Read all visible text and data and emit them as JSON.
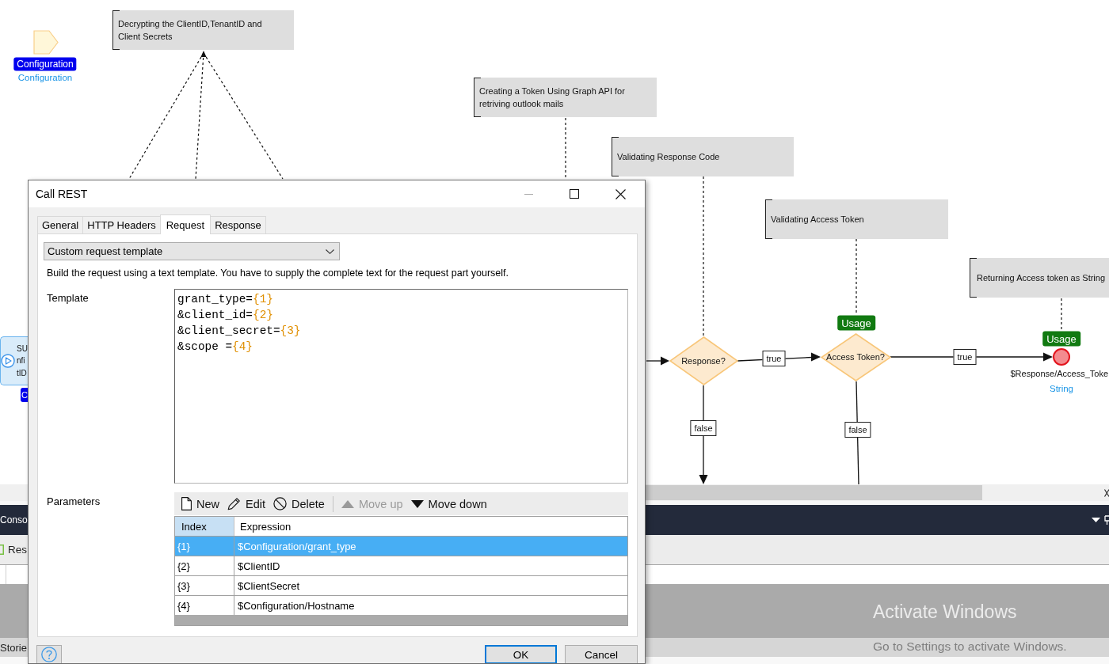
{
  "diagram": {
    "parameter": {
      "name": "Configuration",
      "type": "Configuration"
    },
    "annotations": [
      "Decrypting the ClientID,TenantID and Client Secrets",
      "Creating a Token Using Graph API for retriving outlook mails",
      "Validating Response Code",
      "Validating Access Token",
      "Returning Access token as String"
    ],
    "activity": {
      "lines": [
        "SU",
        "nfi",
        "tID"
      ],
      "badge": "C"
    },
    "decisions": [
      {
        "label": "Response?",
        "true_label": "true",
        "false_label": "false"
      },
      {
        "label": "Access Token?",
        "usage": "Usage",
        "true_label": "true",
        "false_label": "false"
      }
    ],
    "end_event": {
      "usage": "Usage",
      "return_value": "$Response/Access_Toke",
      "type": "String"
    }
  },
  "dialog": {
    "title": "Call REST",
    "tabs": [
      {
        "label": "General",
        "selected": false
      },
      {
        "label": "HTTP Headers",
        "selected": false
      },
      {
        "label": "Request",
        "selected": true
      },
      {
        "label": "Response",
        "selected": false
      }
    ],
    "request_type": "Custom request template",
    "description": "Build the request using a text template. You have to supply the complete text for the request part yourself.",
    "template_label": "Template",
    "template_lines": [
      {
        "text": "grant_type=",
        "param": "{1}"
      },
      {
        "text": "&client_id=",
        "param": "{2}"
      },
      {
        "text": "&client_secret=",
        "param": "{3}"
      },
      {
        "text": "&scope =",
        "param": "{4}"
      }
    ],
    "parameters_label": "Parameters",
    "toolbar_groups": [
      [
        {
          "label": "New",
          "kind": "new",
          "disabled": false
        },
        {
          "label": "Edit",
          "kind": "edit",
          "disabled": false
        },
        {
          "label": "Delete",
          "kind": "delete",
          "disabled": false
        }
      ],
      [
        {
          "label": "Move up",
          "kind": "move_up",
          "disabled": true
        },
        {
          "label": "Move down",
          "kind": "move_down",
          "disabled": false
        }
      ]
    ],
    "columns": [
      {
        "label": "Index",
        "highlighted": true
      },
      {
        "label": "Expression",
        "highlighted": false
      }
    ],
    "rows": [
      {
        "index": "{1}",
        "expression": "$Configuration/grant_type",
        "selected": true
      },
      {
        "index": "{2}",
        "expression": "$ClientID",
        "selected": false
      },
      {
        "index": "{3}",
        "expression": "$ClientSecret",
        "selected": false
      },
      {
        "index": "{4}",
        "expression": "$Configuration/Hostname",
        "selected": false
      }
    ],
    "buttons": [
      {
        "label": "OK",
        "default": true
      },
      {
        "label": "Cancel",
        "default": false
      }
    ]
  },
  "console_pane": {
    "title": "Conso",
    "toolbar_item": "Res",
    "tab": "Storie"
  },
  "activation_notice": {
    "title": "Activate Windows",
    "hint": "Go to Settings to activate Windows."
  }
}
